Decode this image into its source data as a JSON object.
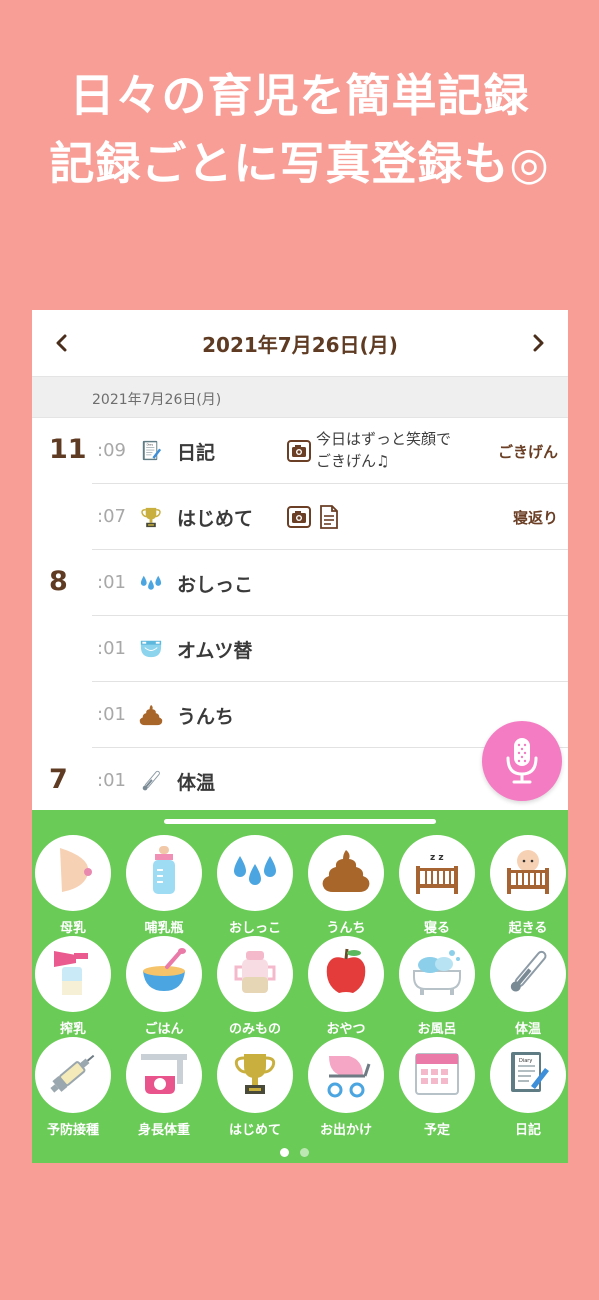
{
  "colors": {
    "background": "#F89E97",
    "panel": "#6ACB57",
    "accent_brown": "#5E3B22",
    "mic": "#F47CC3"
  },
  "headline": {
    "line1": "日々の育児を簡単記録",
    "line2": "記録ごとに写真登録も◎"
  },
  "header": {
    "prev_icon": "chevron-left-icon",
    "next_icon": "chevron-right-icon",
    "date_title": "2021年7月26日(月)"
  },
  "day_band": {
    "label": "2021年7月26日(月)"
  },
  "timeline": [
    {
      "hour": "11",
      "minute": ":09",
      "icon": "diary-icon",
      "label": "日記",
      "has_photo": true,
      "note": "今日はずっと笑顔でごきげん♫",
      "tag": "ごきげん"
    },
    {
      "hour": "",
      "minute": ":07",
      "icon": "trophy-icon",
      "label": "はじめて",
      "has_photo": true,
      "has_memo": true,
      "tag": "寝返り"
    },
    {
      "hour": "8",
      "minute": ":01",
      "icon": "droplets-icon",
      "label": "おしっこ"
    },
    {
      "hour": "",
      "minute": ":01",
      "icon": "diaper-icon",
      "label": "オムツ替"
    },
    {
      "hour": "",
      "minute": ":01",
      "icon": "poop-icon",
      "label": "うんち"
    },
    {
      "hour": "7",
      "minute": ":01",
      "icon": "thermometer-icon",
      "label": "体温"
    }
  ],
  "quick_buttons": [
    {
      "label": "母乳",
      "icon": "breast-icon"
    },
    {
      "label": "哺乳瓶",
      "icon": "baby-bottle-icon"
    },
    {
      "label": "おしっこ",
      "icon": "droplets-icon"
    },
    {
      "label": "うんち",
      "icon": "poop-icon"
    },
    {
      "label": "寝る",
      "icon": "crib-sleep-icon"
    },
    {
      "label": "起きる",
      "icon": "crib-awake-icon"
    },
    {
      "label": "搾乳",
      "icon": "breast-pump-icon"
    },
    {
      "label": "ごはん",
      "icon": "food-bowl-icon"
    },
    {
      "label": "のみもの",
      "icon": "sippy-cup-icon"
    },
    {
      "label": "おやつ",
      "icon": "apple-icon"
    },
    {
      "label": "お風呂",
      "icon": "bathtub-icon"
    },
    {
      "label": "体温",
      "icon": "thermometer-icon"
    },
    {
      "label": "予防接種",
      "icon": "syringe-icon"
    },
    {
      "label": "身長体重",
      "icon": "scale-icon"
    },
    {
      "label": "はじめて",
      "icon": "trophy-icon"
    },
    {
      "label": "お出かけ",
      "icon": "stroller-icon"
    },
    {
      "label": "予定",
      "icon": "calendar-icon"
    },
    {
      "label": "日記",
      "icon": "diary-icon"
    }
  ],
  "pager": {
    "pages": 2,
    "current": 1
  }
}
